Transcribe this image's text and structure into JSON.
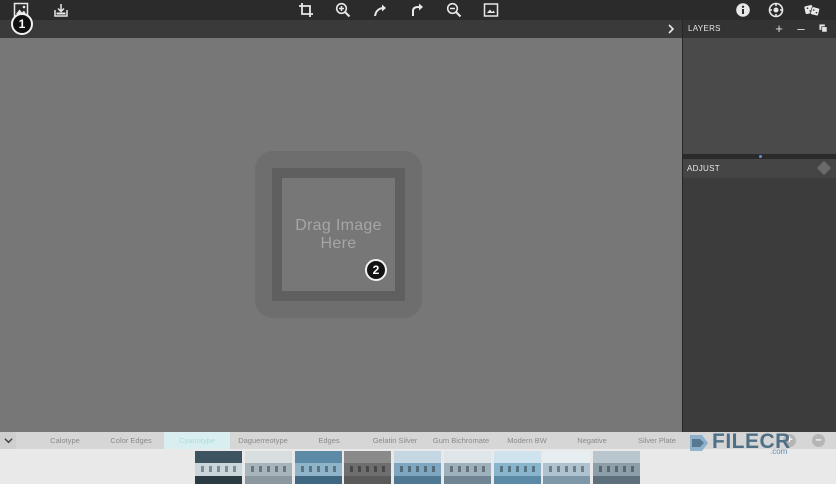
{
  "toolbar": {
    "left_icons": [
      "open-image-icon",
      "import-icon"
    ],
    "center_icons": [
      "crop-icon",
      "zoom-in-icon",
      "undo-icon",
      "redo-icon",
      "zoom-out-icon",
      "fit-screen-icon"
    ],
    "right_icons": [
      "info-icon",
      "settings-icon",
      "random-dice-icon"
    ]
  },
  "canvas": {
    "drop_text_line1": "Drag Image",
    "drop_text_line2": "Here"
  },
  "callouts": {
    "first": "1",
    "second": "2"
  },
  "layers": {
    "title": "LAYERS",
    "add": "+",
    "remove": "–"
  },
  "adjust": {
    "title": "ADJUST"
  },
  "presets": {
    "active_index": 2,
    "items": [
      "Calotype",
      "Color Edges",
      "Cyanotype",
      "Daguerreotype",
      "Edges",
      "Gelatin Silver",
      "Gum Bichromate",
      "Modern BW",
      "Negative",
      "Silver Plate"
    ],
    "next": "+",
    "prev": "–"
  },
  "watermark": {
    "brand": "FILECR",
    "domain": ".com"
  },
  "colors": {
    "canvas": "#777777",
    "toolbar": "#2b2b2b",
    "active_preset": "#d9efef",
    "accent": "#5b8fd6"
  }
}
